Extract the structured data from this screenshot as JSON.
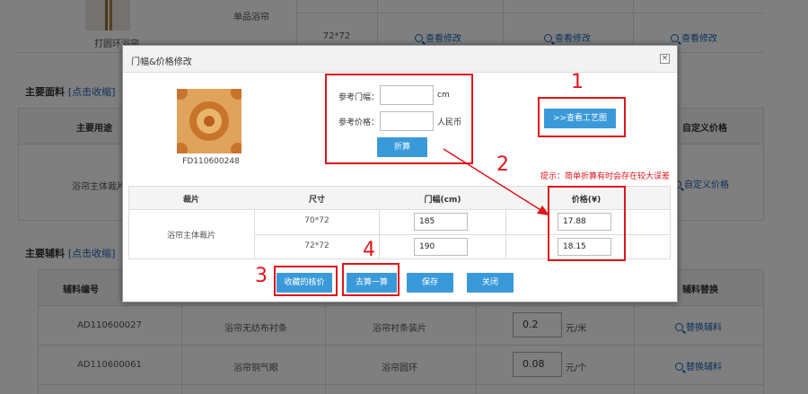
{
  "background": {
    "top_row": {
      "product_name": "打圆环浴帘",
      "product_type": "单品浴帘",
      "size": "72*72",
      "links": [
        "查看修改",
        "查看修改",
        "查看修改"
      ]
    },
    "main_fabric": {
      "title": "主要面料",
      "toggle": "[点击收缩]",
      "col_usage": "主要用途",
      "col_custom_price": "自定义价格",
      "row_usage": "浴帘主体裁片",
      "row_link": "自定义价格"
    },
    "main_accessory": {
      "title": "主要辅料",
      "toggle": "[点击收缩]",
      "col_code": "辅料编号",
      "col_replace": "辅料替换",
      "rows": [
        {
          "code": "AD110600027",
          "name": "浴帘无纺布衬条",
          "usage": "浴帘衬条装片",
          "qty": "0.2",
          "unit": "元/米",
          "link": "替换辅料"
        },
        {
          "code": "AD110600061",
          "name": "浴帘铜气眼",
          "usage": "浴帘圆环",
          "qty": "0.08",
          "unit": "元/个",
          "link": "替换辅料"
        }
      ]
    }
  },
  "dialog": {
    "title": "门幅&价格修改",
    "close_icon": "×",
    "fabric_code": "FD110600248",
    "ref_width_label": "参考门幅：",
    "ref_width_unit": "cm",
    "ref_price_label": "参考价格：",
    "ref_price_unit": "人民币",
    "convert_button": "折算",
    "view_process_button": ">>查看工艺图",
    "hint": "提示：简单折算有时会存在较大误差",
    "table": {
      "headers": [
        "裁片",
        "尺寸",
        "门幅(cm)",
        "价格(¥)"
      ],
      "piece": "浴帘主体裁片",
      "rows": [
        {
          "size": "70*72",
          "width": "185",
          "price": "17.88"
        },
        {
          "size": "72*72",
          "width": "190",
          "price": "18.15"
        }
      ]
    },
    "buttons": {
      "saved_price": "收藏的核价",
      "calc": "去算一算",
      "save": "保存",
      "close": "关闭"
    }
  },
  "annotations": [
    "1",
    "2",
    "3",
    "4"
  ],
  "colors": {
    "accent_blue": "#3a9ad9",
    "link_blue": "#1a63b5",
    "annotation_red": "#e0151b"
  }
}
